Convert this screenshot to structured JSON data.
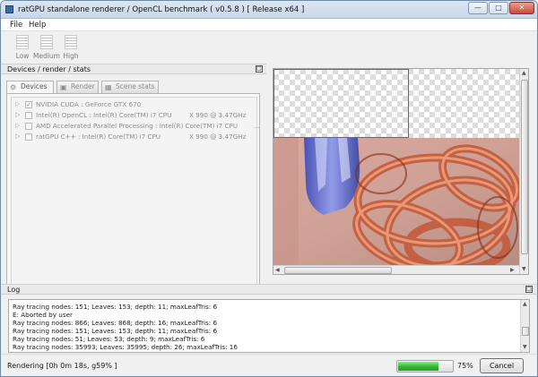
{
  "window": {
    "title": "ratGPU standalone renderer / OpenCL benchmark ( v0.5.8 ) [ Release x64 ]"
  },
  "menu": {
    "file": "File",
    "help": "Help"
  },
  "toolbar": {
    "low": "Low",
    "medium": "Medium",
    "high": "High"
  },
  "devices_panel": {
    "title": "Devices / render / stats",
    "tabs": {
      "devices": "Devices",
      "render": "Render",
      "scene": "Scene stats"
    },
    "devices": [
      {
        "name": "NVIDIA CUDA : GeForce GTX 670",
        "clock": "",
        "checked": true
      },
      {
        "name": "Intel(R) OpenCL : Intel(R) Core(TM) i7 CPU",
        "clock": "X 990  @ 3.47GHz",
        "checked": false
      },
      {
        "name": "AMD Accelerated Parallel Processing : Intel(R) Core(TM) i7 CPU",
        "clock": "...",
        "checked": false
      },
      {
        "name": "ratGPU C++ : Intel(R) Core(TM) i7 CPU",
        "clock": "X 990  @ 3.47GHz",
        "checked": false
      }
    ]
  },
  "log": {
    "title": "Log",
    "lines": [
      "Ray tracing nodes: 151; Leaves: 153; depth: 11; maxLeafTris: 6",
      "E: Aborted by user",
      "Ray tracing nodes: 866; Leaves: 868; depth: 16; maxLeafTris: 6",
      "Ray tracing nodes: 151; Leaves: 153; depth: 11; maxLeafTris: 6",
      "Ray tracing nodes: 51; Leaves: 53; depth: 9; maxLeafTris: 6",
      "Ray tracing nodes: 35993; Leaves: 35995; depth: 26; maxLeafTris: 16"
    ]
  },
  "status": {
    "text": "Rendering [0h 0m 18s, g59% ]",
    "progress_percent": 75,
    "progress_label": "75%",
    "cancel": "Cancel"
  },
  "colors": {
    "progress_green": "#2fb12f",
    "tile_border": "#b24a3e"
  }
}
